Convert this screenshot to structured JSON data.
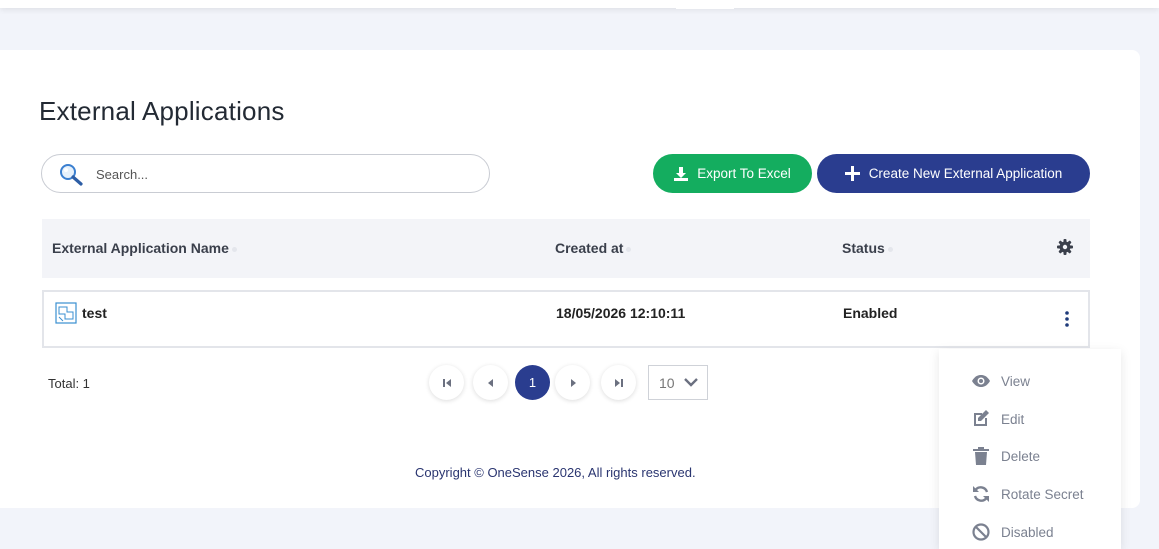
{
  "page": {
    "title": "External Applications"
  },
  "search": {
    "placeholder": "Search...",
    "value": ""
  },
  "toolbar": {
    "export_label": "Export To Excel",
    "create_label": "Create New External Application"
  },
  "table": {
    "columns": [
      "External Application Name",
      "Created at",
      "Status"
    ],
    "rows": [
      {
        "name": "test",
        "created_at": "18/05/2026 12:10:11",
        "status": "Enabled"
      }
    ]
  },
  "footer": {
    "total_label": "Total: 1",
    "current_page": "1",
    "page_size": "10",
    "copyright": "Copyright © OneSense 2026, All rights reserved."
  },
  "actions_menu": {
    "items": [
      {
        "label": "View",
        "icon": "eye-icon"
      },
      {
        "label": "Edit",
        "icon": "edit-icon"
      },
      {
        "label": "Delete",
        "icon": "trash-icon"
      },
      {
        "label": "Rotate Secret",
        "icon": "rotate-icon"
      },
      {
        "label": "Disabled",
        "icon": "ban-icon"
      }
    ]
  },
  "colors": {
    "primary": "#2a3d8f",
    "success": "#14ad5f",
    "background": "#f2f4fa"
  }
}
